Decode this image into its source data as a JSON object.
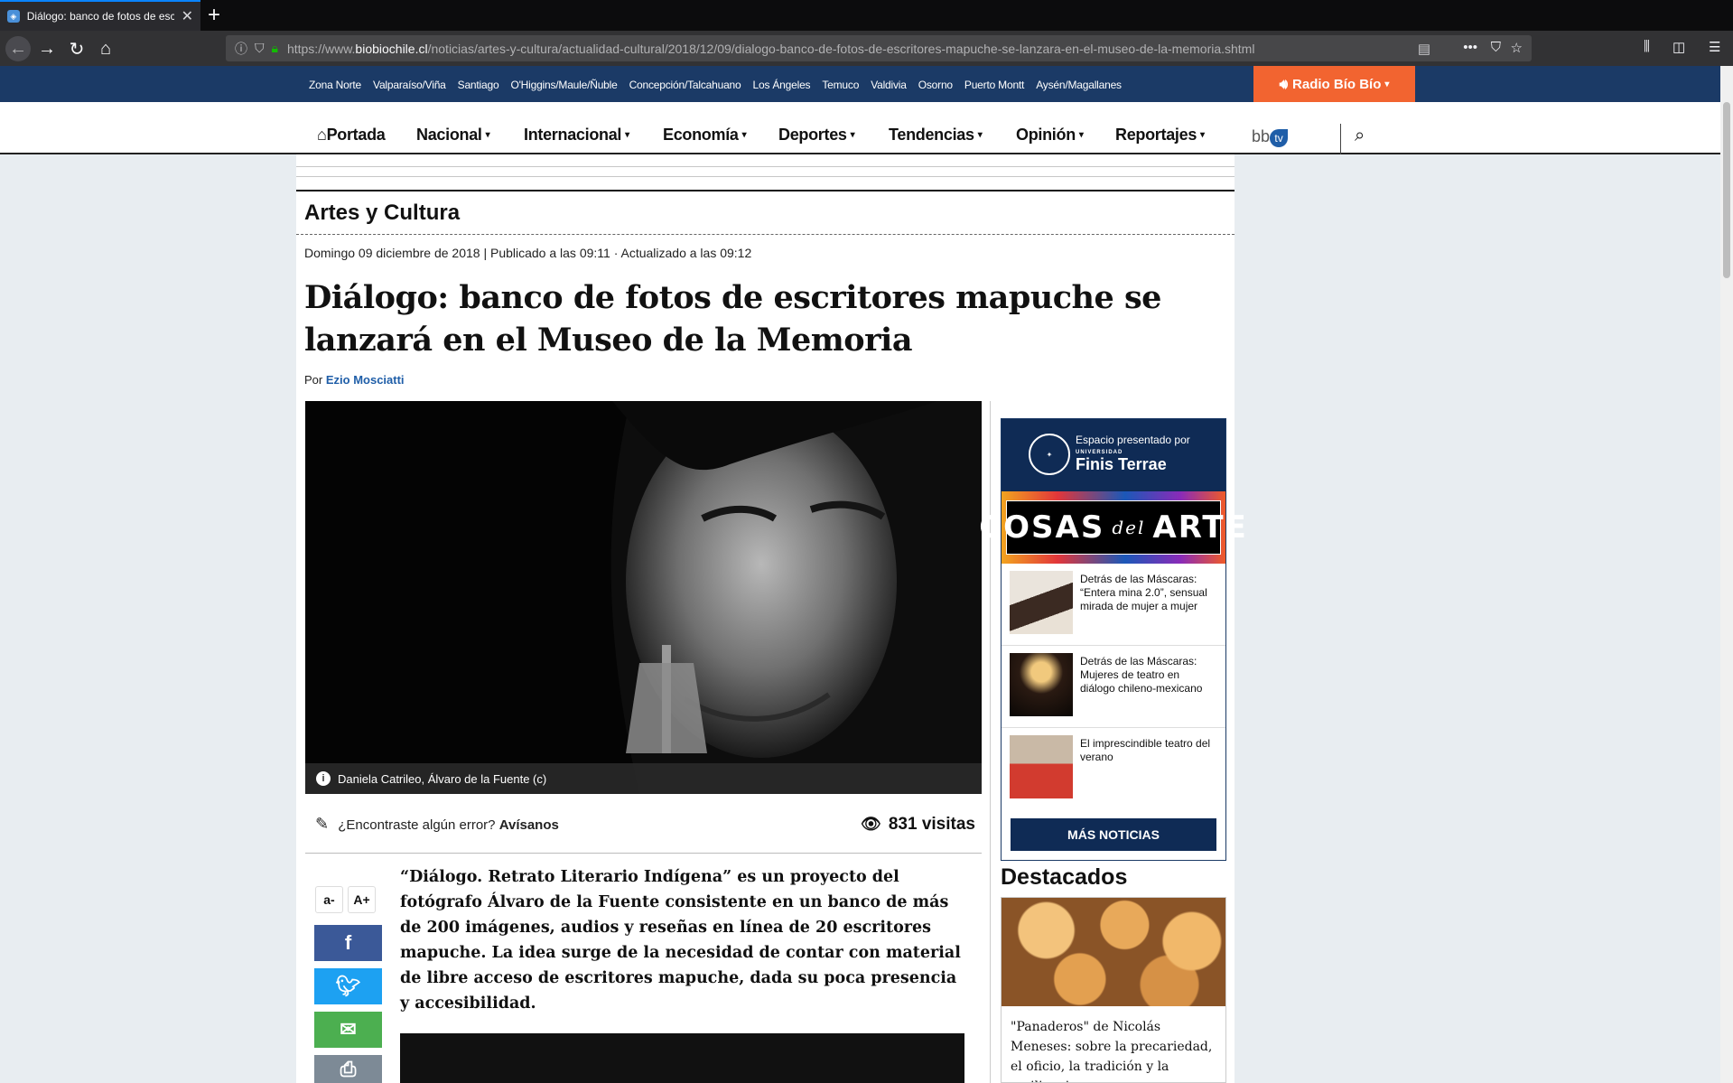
{
  "browser": {
    "tab_title": "Diálogo: banco de fotos de escritores mapuche se lanzará en el Museo de la Memoria",
    "url_prefix": "https://www.",
    "url_domain": "biobiochile.cl",
    "url_path": "/noticias/artes-y-cultura/actualidad-cultural/2018/12/09/dialogo-banco-de-fotos-de-escritores-mapuche-se-lanzara-en-el-museo-de-la-memoria.shtml",
    "accent": "#0a84ff"
  },
  "regions": [
    "Zona Norte",
    "Valparaíso/Viña",
    "Santiago",
    "O'Higgins/Maule/Ñuble",
    "Concepción/Talcahuano",
    "Los Ángeles",
    "Temuco",
    "Valdivia",
    "Osorno",
    "Puerto Montt",
    "Aysén/Magallanes"
  ],
  "radio_button": "Radio Bío Bío",
  "nav": {
    "portada": "Portada",
    "nacional": "Nacional",
    "internacional": "Internacional",
    "economia": "Economía",
    "deportes": "Deportes",
    "tendencias": "Tendencias",
    "opinion": "Opinión",
    "reportajes": "Reportajes",
    "bbtv_text": "bb",
    "bbtv_badge": "tv"
  },
  "section": "Artes y Cultura",
  "article": {
    "dateline": "Domingo 09 diciembre de 2018 | Publicado a las 09:11 · Actualizado a las 09:12",
    "headline": "Diálogo: banco de fotos de escritores mapuche se lanzará en el Museo de la Memoria",
    "by_label": "Por",
    "author": "Ezio Mosciatti",
    "caption": "Daniela Catrileo, Álvaro de la Fuente (c)",
    "error_question": "¿Encontraste algún error?",
    "error_link": "Avísanos",
    "visits": "831 visitas",
    "font_smaller": "a-",
    "font_bigger": "A+",
    "lead": "“Diálogo. Retrato Literario Indígena” es un proyecto del fotógrafo Álvaro de la Fuente consistente en un banco de más de 200 imágenes, audios y reseñas en línea de 20 escritores mapuche. La idea surge de la necesidad de contar con material de libre acceso de escritores mapuche, dada su poca presencia y accesibilidad."
  },
  "share": {
    "facebook_color": "#3b5998",
    "twitter_color": "#1da1f2",
    "email_color": "#4caf50",
    "print_color": "#7d8a96"
  },
  "sidebar": {
    "sponsor_line": "Espacio presentado por",
    "sponsor_small": "UNIVERSIDAD",
    "sponsor_name": "Finis Terrae",
    "cosas_left": "COSAS",
    "cosas_mid": "del",
    "cosas_right": "ARTE",
    "items": [
      {
        "text": "Detrás de las Máscaras: “Entera mina 2.0”, sensual mirada de mujer a mujer"
      },
      {
        "text": "Detrás de las Máscaras: Mujeres de teatro en diálogo chileno-mexicano"
      },
      {
        "text": "El imprescindible teatro del verano"
      }
    ],
    "more_button": "MÁS NOTICIAS",
    "destacados": "Destacados",
    "destacado_text": "\"Panaderos\" de Nicolás Meneses: sobre la precariedad, el oficio, la tradición y la resiliencia"
  }
}
